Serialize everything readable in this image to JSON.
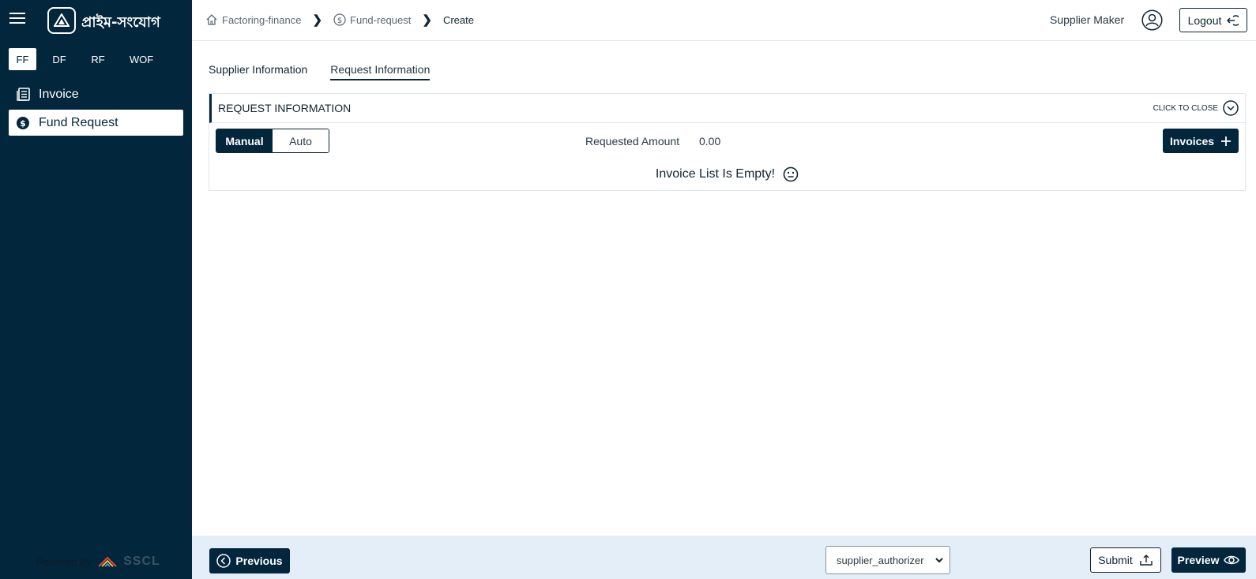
{
  "app": {
    "brand": "প্রাইম-সংযোগ"
  },
  "sidebar": {
    "mode_tabs": [
      {
        "label": "FF",
        "active": true
      },
      {
        "label": "DF",
        "active": false
      },
      {
        "label": "RF",
        "active": false
      },
      {
        "label": "WOF",
        "active": false
      }
    ],
    "items": [
      {
        "label": "Invoice",
        "icon": "list-icon",
        "active": false
      },
      {
        "label": "Fund Request",
        "icon": "dollar-circle-icon",
        "active": true
      }
    ],
    "powered_by": "Powered By",
    "company": "SSCL"
  },
  "header": {
    "breadcrumb": [
      {
        "label": "Factoring-finance",
        "icon": "home-icon"
      },
      {
        "label": "Fund-request",
        "icon": "dollar-circle-icon"
      },
      {
        "label": "Create"
      }
    ],
    "user": "Supplier Maker",
    "logout_label": "Logout"
  },
  "tabs": [
    {
      "label": "Supplier Information",
      "active": false
    },
    {
      "label": "Request Information",
      "active": true
    }
  ],
  "section": {
    "title": "REQUEST INFORMATION",
    "close_label": "CLICK TO CLOSE",
    "mode_toggle": {
      "manual": "Manual",
      "auto": "Auto",
      "selected": "Manual"
    },
    "requested_amount_label": "Requested Amount",
    "requested_amount_value": "0.00",
    "invoices_button": "Invoices",
    "empty_message": "Invoice List Is Empty!"
  },
  "footer": {
    "previous_label": "Previous",
    "authorizer_select": "supplier_authorizer",
    "submit_label": "Submit",
    "preview_label": "Preview"
  },
  "colors": {
    "primary": "#02263b",
    "footer_bg": "#e3eef8",
    "border": "#e3e7ea"
  }
}
